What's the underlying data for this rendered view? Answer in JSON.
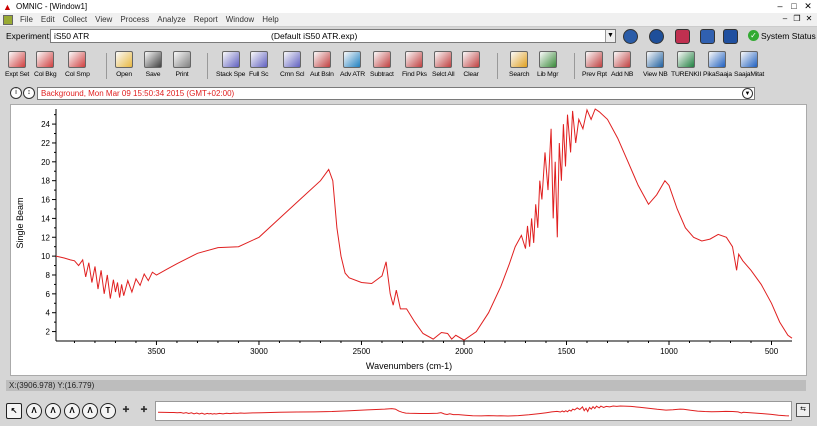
{
  "window": {
    "app_icon": "omnic-logo-icon",
    "title": "OMNIC - [Window1]"
  },
  "menu": [
    "File",
    "Edit",
    "Collect",
    "View",
    "Process",
    "Analyze",
    "Report",
    "Window",
    "Help"
  ],
  "experiment": {
    "label": "Experiment:",
    "name": "iS50 ATR",
    "file": "(Default iS50 ATR.exp)",
    "system_status": "System Status"
  },
  "toolbar": [
    {
      "label": "Expt Set",
      "icon": "experiment-setup-icon",
      "color": "#d04040"
    },
    {
      "label": "Col Bkg",
      "icon": "collect-background-icon",
      "color": "#d04040"
    },
    {
      "label": "Col Smp",
      "icon": "collect-sample-icon",
      "color": "#d04040"
    },
    {
      "label": "Open",
      "icon": "open-folder-icon",
      "color": "#e8b840"
    },
    {
      "label": "Save",
      "icon": "save-disk-icon",
      "color": "#404040"
    },
    {
      "label": "Print",
      "icon": "printer-icon",
      "color": "#808080"
    },
    {
      "label": "Stack Spe",
      "icon": "stack-spectra-icon",
      "color": "#6060c0"
    },
    {
      "label": "Full Sc",
      "icon": "full-scale-icon",
      "color": "#6060c0"
    },
    {
      "label": "Cmn Scl",
      "icon": "common-scale-icon",
      "color": "#6060c0"
    },
    {
      "label": "Aut Bsln",
      "icon": "auto-baseline-icon",
      "color": "#c04040"
    },
    {
      "label": "Adv ATR",
      "icon": "advanced-atr-icon",
      "color": "#2080c0"
    },
    {
      "label": "Subtract",
      "icon": "subtract-icon",
      "color": "#c04040"
    },
    {
      "label": "Find Pks",
      "icon": "find-peaks-icon",
      "color": "#c04040"
    },
    {
      "label": "Selct All",
      "icon": "select-all-icon",
      "color": "#c04040"
    },
    {
      "label": "Clear",
      "icon": "clear-icon",
      "color": "#c04040"
    },
    {
      "label": "Search",
      "icon": "search-icon",
      "color": "#e0a020"
    },
    {
      "label": "Lib Mgr",
      "icon": "library-manager-icon",
      "color": "#3a8a3a"
    },
    {
      "label": "Prev Rpt",
      "icon": "preview-report-icon",
      "color": "#c04040"
    },
    {
      "label": "Add NB",
      "icon": "add-notebook-icon",
      "color": "#c04040"
    },
    {
      "label": "View NB",
      "icon": "view-notebook-icon",
      "color": "#2060a0"
    },
    {
      "label": "TURENKII",
      "icon": "turenkii-icon",
      "color": "#208040"
    },
    {
      "label": "PikaSaaja",
      "icon": "pikasaaja-icon",
      "color": "#2060c0"
    },
    {
      "label": "SaajaMitat",
      "icon": "saajamitat-icon",
      "color": "#2060c0"
    }
  ],
  "spectrum_title": "Background, Mon Mar 09 15:50:34 2015 (GMT+02:00)",
  "status_readout": "X:(3906.978) Y:(16.779)",
  "chart_data": {
    "type": "line",
    "xlabel": "Wavenumbers (cm-1)",
    "ylabel": "Single Beam",
    "xlim": [
      3990,
      400
    ],
    "ylim": [
      1.0,
      25.6
    ],
    "xticks": [
      3500,
      3000,
      2500,
      2000,
      1500,
      1000,
      500
    ],
    "yticks": [
      2,
      4,
      6,
      8,
      10,
      12,
      14,
      16,
      18,
      20,
      22,
      24
    ],
    "grid": false,
    "series": [
      {
        "color": "#e02020",
        "points": [
          [
            3990,
            10.0
          ],
          [
            3950,
            9.8
          ],
          [
            3920,
            9.6
          ],
          [
            3900,
            9.5
          ],
          [
            3880,
            9.0
          ],
          [
            3860,
            9.6
          ],
          [
            3845,
            7.8
          ],
          [
            3830,
            9.3
          ],
          [
            3815,
            7.2
          ],
          [
            3800,
            8.9
          ],
          [
            3785,
            6.5
          ],
          [
            3770,
            8.5
          ],
          [
            3755,
            6.0
          ],
          [
            3740,
            8.0
          ],
          [
            3725,
            5.5
          ],
          [
            3710,
            7.5
          ],
          [
            3700,
            6.2
          ],
          [
            3690,
            7.2
          ],
          [
            3680,
            5.6
          ],
          [
            3670,
            7.0
          ],
          [
            3660,
            5.8
          ],
          [
            3640,
            7.4
          ],
          [
            3620,
            6.2
          ],
          [
            3600,
            7.6
          ],
          [
            3580,
            6.9
          ],
          [
            3560,
            8.1
          ],
          [
            3540,
            7.4
          ],
          [
            3520,
            8.3
          ],
          [
            3500,
            8.0
          ],
          [
            3450,
            8.6
          ],
          [
            3400,
            9.2
          ],
          [
            3300,
            10.3
          ],
          [
            3200,
            10.9
          ],
          [
            3100,
            11.0
          ],
          [
            3000,
            12.0
          ],
          [
            2900,
            14.0
          ],
          [
            2800,
            16.0
          ],
          [
            2700,
            18.0
          ],
          [
            2660,
            19.2
          ],
          [
            2640,
            18.0
          ],
          [
            2620,
            13.0
          ],
          [
            2600,
            10.0
          ],
          [
            2580,
            8.2
          ],
          [
            2560,
            7.7
          ],
          [
            2500,
            7.2
          ],
          [
            2450,
            7.1
          ],
          [
            2400,
            7.9
          ],
          [
            2380,
            9.4
          ],
          [
            2360,
            6.0
          ],
          [
            2345,
            4.8
          ],
          [
            2330,
            6.4
          ],
          [
            2310,
            4.4
          ],
          [
            2280,
            4.4
          ],
          [
            2240,
            3.0
          ],
          [
            2200,
            1.8
          ],
          [
            2150,
            1.2
          ],
          [
            2110,
            1.9
          ],
          [
            2080,
            1.8
          ],
          [
            2060,
            1.2
          ],
          [
            2040,
            1.6
          ],
          [
            2000,
            1.1
          ],
          [
            1940,
            2.0
          ],
          [
            1880,
            4.0
          ],
          [
            1820,
            6.8
          ],
          [
            1780,
            9.1
          ],
          [
            1750,
            11.0
          ],
          [
            1720,
            12.2
          ],
          [
            1700,
            10.8
          ],
          [
            1690,
            13.2
          ],
          [
            1680,
            11.0
          ],
          [
            1670,
            14.0
          ],
          [
            1660,
            11.4
          ],
          [
            1650,
            15.5
          ],
          [
            1640,
            13.0
          ],
          [
            1630,
            18.0
          ],
          [
            1620,
            16.0
          ],
          [
            1605,
            21.0
          ],
          [
            1590,
            17.0
          ],
          [
            1575,
            23.5
          ],
          [
            1565,
            14.0
          ],
          [
            1555,
            20.0
          ],
          [
            1545,
            12.0
          ],
          [
            1535,
            22.0
          ],
          [
            1525,
            18.0
          ],
          [
            1515,
            24.0
          ],
          [
            1505,
            19.5
          ],
          [
            1495,
            25.0
          ],
          [
            1480,
            21.0
          ],
          [
            1470,
            25.4
          ],
          [
            1455,
            22.0
          ],
          [
            1440,
            24.5
          ],
          [
            1420,
            23.5
          ],
          [
            1400,
            25.5
          ],
          [
            1380,
            24.5
          ],
          [
            1360,
            25.6
          ],
          [
            1340,
            25.3
          ],
          [
            1300,
            24.5
          ],
          [
            1250,
            22.5
          ],
          [
            1200,
            20.0
          ],
          [
            1150,
            17.5
          ],
          [
            1100,
            15.5
          ],
          [
            1060,
            16.5
          ],
          [
            1020,
            18.0
          ],
          [
            1000,
            17.5
          ],
          [
            960,
            15.0
          ],
          [
            920,
            13.0
          ],
          [
            880,
            12.0
          ],
          [
            840,
            11.6
          ],
          [
            800,
            11.8
          ],
          [
            760,
            12.3
          ],
          [
            720,
            12.0
          ],
          [
            690,
            11.0
          ],
          [
            670,
            8.5
          ],
          [
            660,
            10.2
          ],
          [
            640,
            9.5
          ],
          [
            600,
            8.5
          ],
          [
            550,
            7.0
          ],
          [
            500,
            5.0
          ],
          [
            460,
            3.0
          ],
          [
            420,
            1.6
          ],
          [
            400,
            1.3
          ]
        ]
      }
    ]
  }
}
